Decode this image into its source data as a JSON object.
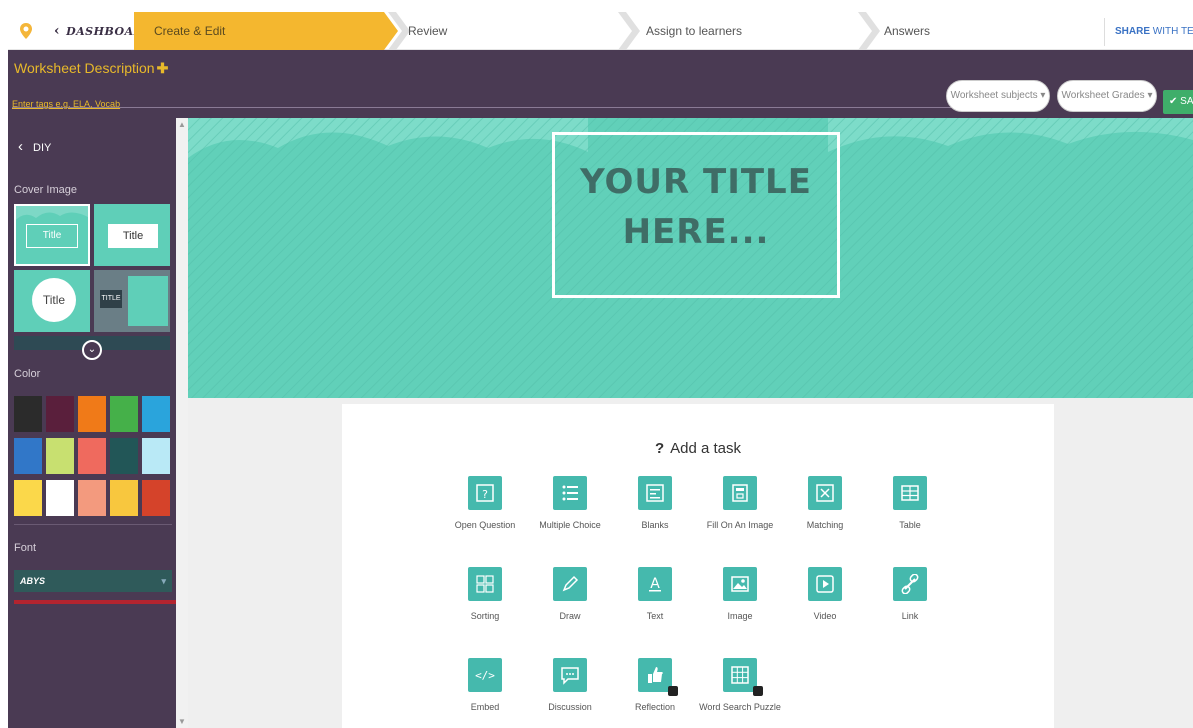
{
  "topbar": {
    "dashboard_label": "DASHBOARD",
    "steps": [
      "Create & Edit",
      "Review",
      "Assign to learners",
      "Answers"
    ],
    "share": {
      "strong": "SHARE",
      "rest": " WITH TEACHER"
    }
  },
  "header": {
    "description_title": "Worksheet Description",
    "tags_placeholder": "Enter tags e.g. ELA, Vocab",
    "subjects_label": "Worksheet subjects ▾",
    "grades_label": "Worksheet Grades ▾",
    "save_label": "✔ SAVE"
  },
  "sidebar": {
    "back_label": "DIY",
    "cover_label": "Cover Image",
    "cover_thumbs": [
      "Title",
      "Title",
      "Title",
      "TITLE"
    ],
    "color_label": "Color",
    "colors": [
      "#2b2b2b",
      "#5a1f3c",
      "#f07a18",
      "#45b049",
      "#2aa4dc",
      "#3177c8",
      "#c8e070",
      "#ef6a5e",
      "#225657",
      "#b9e9f6",
      "#fbd84a",
      "#ffffff",
      "#f39a7e",
      "#f8c73e",
      "#d5432a"
    ],
    "font_label": "Font",
    "font_value": "ABYS"
  },
  "cover": {
    "title_line1": "YOUR TITLE",
    "title_line2": "HERE..."
  },
  "tasks": {
    "heading": "Add a task",
    "items": [
      {
        "label": "Open Question",
        "icon": "open-question-icon"
      },
      {
        "label": "Multiple Choice",
        "icon": "multiple-choice-icon"
      },
      {
        "label": "Blanks",
        "icon": "blanks-icon"
      },
      {
        "label": "Fill On An Image",
        "icon": "fill-on-image-icon"
      },
      {
        "label": "Matching",
        "icon": "matching-icon"
      },
      {
        "label": "Table",
        "icon": "table-icon"
      },
      {
        "label": "Sorting",
        "icon": "sorting-icon"
      },
      {
        "label": "Draw",
        "icon": "draw-icon"
      },
      {
        "label": "Text",
        "icon": "text-icon"
      },
      {
        "label": "Image",
        "icon": "image-icon"
      },
      {
        "label": "Video",
        "icon": "video-icon"
      },
      {
        "label": "Link",
        "icon": "link-icon"
      },
      {
        "label": "Embed",
        "icon": "embed-icon"
      },
      {
        "label": "Discussion",
        "icon": "discussion-icon"
      },
      {
        "label": "Reflection",
        "icon": "reflection-icon"
      },
      {
        "label": "Word Search Puzzle",
        "icon": "word-search-icon"
      }
    ]
  }
}
